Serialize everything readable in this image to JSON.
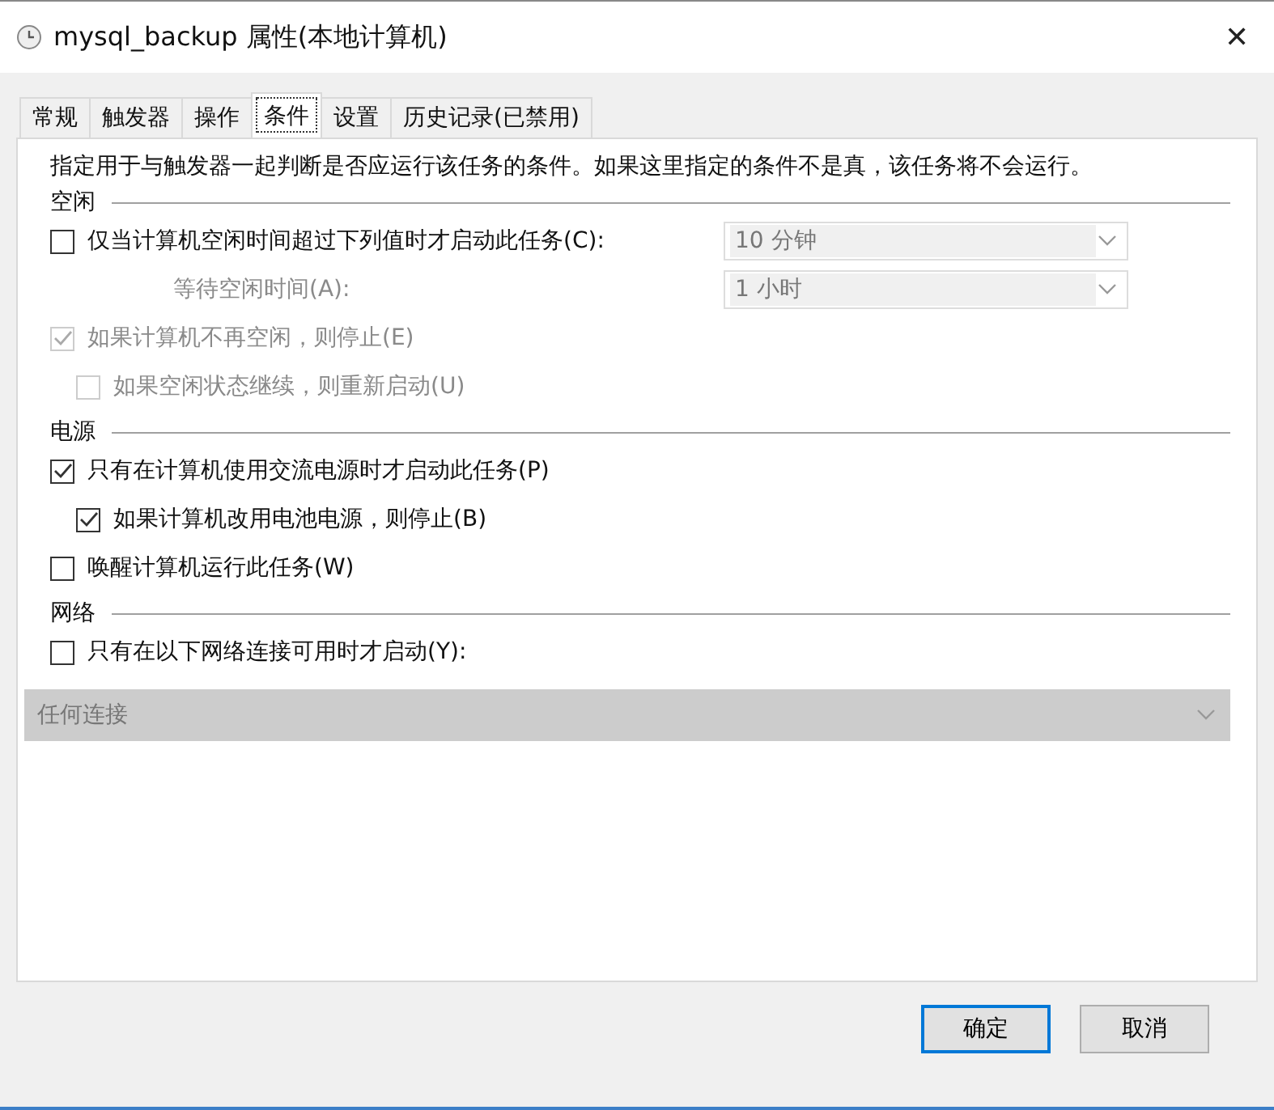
{
  "window": {
    "title": "mysql_backup 属性(本地计算机)",
    "close": "✕"
  },
  "tabs": [
    {
      "label": "常规",
      "selected": false
    },
    {
      "label": "触发器",
      "selected": false
    },
    {
      "label": "操作",
      "selected": false
    },
    {
      "label": "条件",
      "selected": true
    },
    {
      "label": "设置",
      "selected": false
    },
    {
      "label": "历史记录(已禁用)",
      "selected": false
    }
  ],
  "description": "指定用于与触发器一起判断是否应运行该任务的条件。如果这里指定的条件不是真，该任务将不会运行。",
  "sections": [
    {
      "title": "空闲",
      "rows": [
        {
          "kind": "checkbox",
          "label": "仅当计算机空闲时间超过下列值时才启动此任务(C):",
          "checked": false,
          "disabled": false,
          "combo": {
            "value": "10 分钟",
            "disabled": true
          }
        },
        {
          "kind": "label",
          "label": "等待空闲时间(A):",
          "disabled": true,
          "combo": {
            "value": "1 小时",
            "disabled": true
          }
        },
        {
          "kind": "checkbox",
          "label": "如果计算机不再空闲，则停止(E)",
          "checked": true,
          "disabled": true,
          "children": [
            {
              "kind": "checkbox",
              "label": "如果空闲状态继续，则重新启动(U)",
              "checked": false,
              "disabled": true
            }
          ]
        }
      ]
    },
    {
      "title": "电源",
      "rows": [
        {
          "kind": "checkbox",
          "label": "只有在计算机使用交流电源时才启动此任务(P)",
          "checked": true,
          "disabled": false,
          "children": [
            {
              "kind": "checkbox",
              "label": "如果计算机改用电池电源，则停止(B)",
              "checked": true,
              "disabled": false
            }
          ]
        },
        {
          "kind": "checkbox",
          "label": "唤醒计算机运行此任务(W)",
          "checked": false,
          "disabled": false
        }
      ]
    },
    {
      "title": "网络",
      "rows": [
        {
          "kind": "checkbox",
          "label": "只有在以下网络连接可用时才启动(Y):",
          "checked": false,
          "disabled": false
        },
        {
          "kind": "dropdown",
          "value": "任何连接",
          "disabled": true
        }
      ]
    }
  ],
  "buttons": [
    {
      "label": "确定",
      "default": true
    },
    {
      "label": "取消",
      "default": false
    }
  ]
}
